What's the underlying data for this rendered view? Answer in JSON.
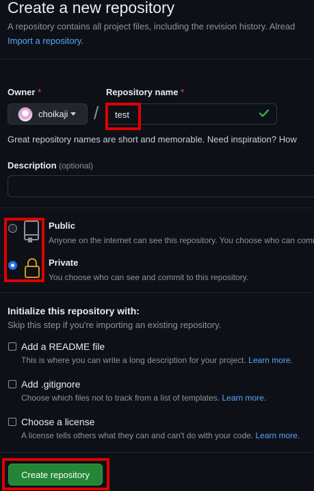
{
  "header": {
    "title": "Create a new repository",
    "subtitle": "A repository contains all project files, including the revision history. Alread",
    "import_link": "Import a repository."
  },
  "owner": {
    "label": "Owner",
    "required_mark": "*",
    "value": "choikaji"
  },
  "separator": "/",
  "repo_name": {
    "label": "Repository name",
    "required_mark": "*",
    "value": "test"
  },
  "hint": "Great repository names are short and memorable. Need inspiration? How",
  "description": {
    "label": "Description",
    "optional": "(optional)",
    "value": ""
  },
  "visibility": {
    "public": {
      "title": "Public",
      "desc": "Anyone on the internet can see this repository. You choose who can comm",
      "selected": false
    },
    "private": {
      "title": "Private",
      "desc": "You choose who can see and commit to this repository.",
      "selected": true
    }
  },
  "init": {
    "heading": "Initialize this repository with:",
    "subheading": "Skip this step if you're importing an existing repository.",
    "items": [
      {
        "title": "Add a README file",
        "desc": "This is where you can write a long description for your project.",
        "link": "Learn more.",
        "checked": false
      },
      {
        "title": "Add .gitignore",
        "desc": "Choose which files not to track from a list of templates.",
        "link": "Learn more.",
        "checked": false
      },
      {
        "title": "Choose a license",
        "desc": "A license tells others what they can and can't do with your code.",
        "link": "Learn more.",
        "checked": false
      }
    ]
  },
  "create_button": "Create repository",
  "colors": {
    "background": "#0d1117",
    "accent": "#1f6feb",
    "button": "#238636",
    "link": "#58a6ff",
    "highlight": "#e00000"
  }
}
